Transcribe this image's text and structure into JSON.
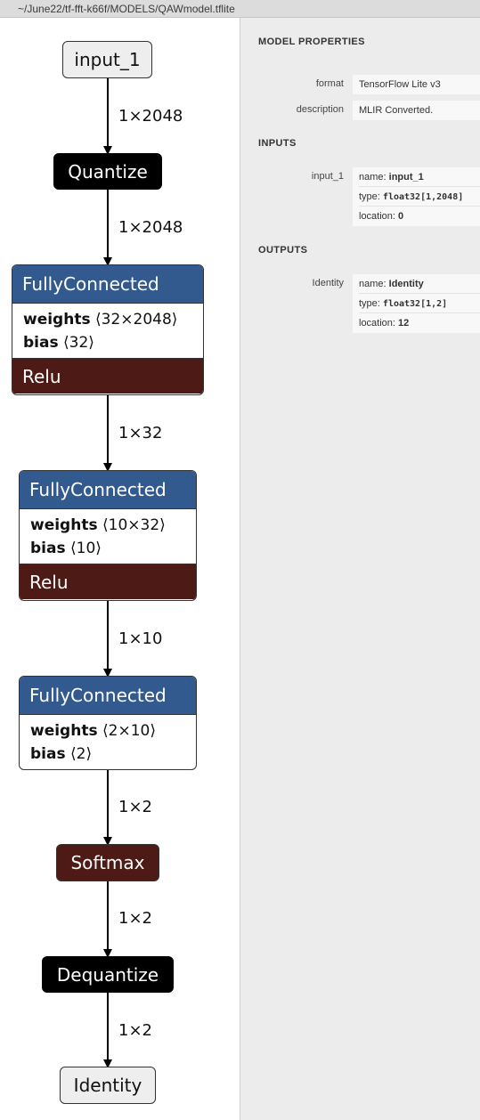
{
  "window": {
    "path": "~/June22/tf-fft-k66f/MODELS/QAWmodel.tflite"
  },
  "graph": {
    "input_node": "input_1",
    "quantize_node": "Quantize",
    "fc1": {
      "title": "FullyConnected",
      "weights_label": "weights",
      "weights_shape": "⟨32×2048⟩",
      "bias_label": "bias",
      "bias_shape": "⟨32⟩",
      "activation": "Relu"
    },
    "fc2": {
      "title": "FullyConnected",
      "weights_label": "weights",
      "weights_shape": "⟨10×32⟩",
      "bias_label": "bias",
      "bias_shape": "⟨10⟩",
      "activation": "Relu"
    },
    "fc3": {
      "title": "FullyConnected",
      "weights_label": "weights",
      "weights_shape": "⟨2×10⟩",
      "bias_label": "bias",
      "bias_shape": "⟨2⟩"
    },
    "softmax_node": "Softmax",
    "dequantize_node": "Dequantize",
    "output_node": "Identity",
    "edges": [
      "1×2048",
      "1×2048",
      "1×32",
      "1×10",
      "1×2",
      "1×2",
      "1×2"
    ]
  },
  "sidebar": {
    "model_properties_title": "MODEL PROPERTIES",
    "format_label": "format",
    "format_value": "TensorFlow Lite v3",
    "description_label": "description",
    "description_value": "MLIR Converted.",
    "inputs_title": "INPUTS",
    "input": {
      "label": "input_1",
      "name_key": "name:",
      "name_value": "input_1",
      "type_key": "type:",
      "type_value": "float32[1,2048]",
      "location_key": "location:",
      "location_value": "0"
    },
    "outputs_title": "OUTPUTS",
    "output": {
      "label": "Identity",
      "name_key": "name:",
      "name_value": "Identity",
      "type_key": "type:",
      "type_value": "float32[1,2]",
      "location_key": "location:",
      "location_value": "12"
    }
  }
}
